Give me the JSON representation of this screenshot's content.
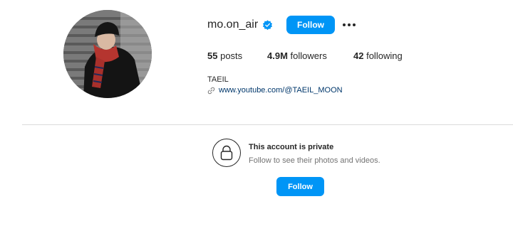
{
  "profile": {
    "username": "mo.on_air",
    "verified_icon": "verified-badge-icon",
    "follow_label": "Follow",
    "more_icon": "more-options-icon",
    "avatar_icon": "profile-photo",
    "stats": {
      "posts_count": "55",
      "posts_label": "posts",
      "followers_count": "4.9M",
      "followers_label": "followers",
      "following_count": "42",
      "following_label": "following"
    },
    "full_name": "TAEIL",
    "link_icon": "link-icon",
    "link_text": "www.youtube.com/@TAEIL_MOON"
  },
  "private": {
    "lock_icon": "lock-icon",
    "title": "This account is private",
    "subtitle": "Follow to see their photos and videos.",
    "follow_label": "Follow"
  },
  "colors": {
    "primary_button": "#0095f6",
    "verified_badge": "#0095f6",
    "link": "#00376b",
    "secondary_text": "#737373",
    "divider": "#dbdbdb"
  }
}
